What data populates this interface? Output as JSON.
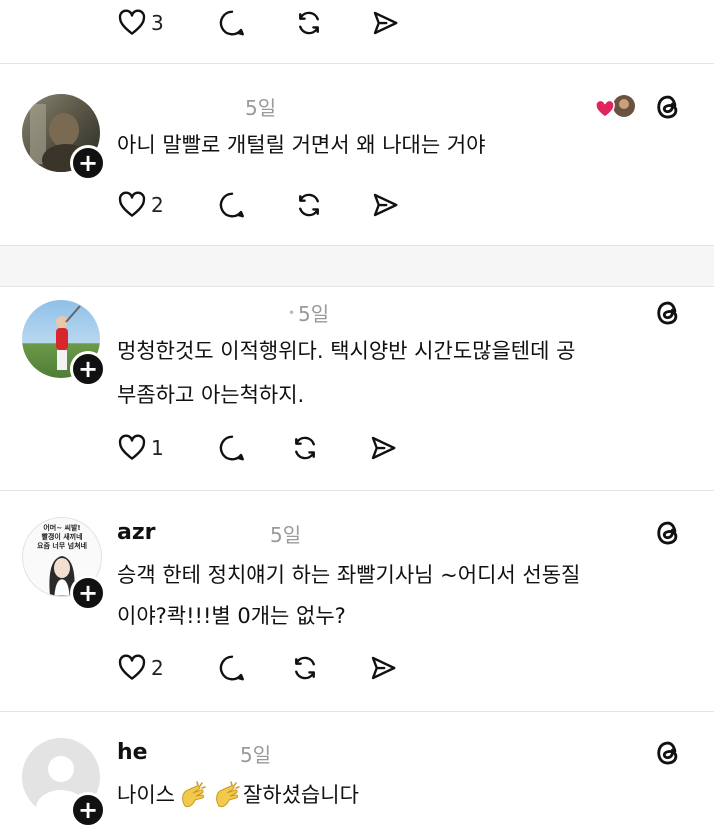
{
  "posts": [
    {
      "likes": "3"
    },
    {
      "time": "5일",
      "text_line1": "아니 말빨로 개털릴 거면서 왜 나대는 거야",
      "likes": "2"
    },
    {
      "time": "5일",
      "text_line1": "멍청한것도 이적행위다. 택시양반 시간도많을텐데 공",
      "text_line2": "부좀하고 아는척하지.",
      "likes": "1"
    },
    {
      "username": "azr",
      "time": "5일",
      "text_line1": "승객 한테  정치얘기 하는 좌빨기사님 ~어디서 선동질",
      "text_line2": "이야?콱!!!별 0개는 없누?",
      "likes": "2",
      "avatar_caption_1": "어머~ 씨발!",
      "avatar_caption_2": "빨갱이 새끼네",
      "avatar_caption_3": "요즘 너무 넘쳐네"
    },
    {
      "username": "he",
      "time": "5일",
      "text_before": "나이스",
      "text_after": "잘하셨습니다"
    }
  ],
  "icons": {
    "like": "heart-outline-icon",
    "reply": "speech-bubble-icon",
    "repost": "repost-icon",
    "share": "send-icon",
    "app": "threads-logo-icon"
  },
  "colors": {
    "heart_reaction": "#e0245e",
    "plus_badge": "#111111"
  }
}
